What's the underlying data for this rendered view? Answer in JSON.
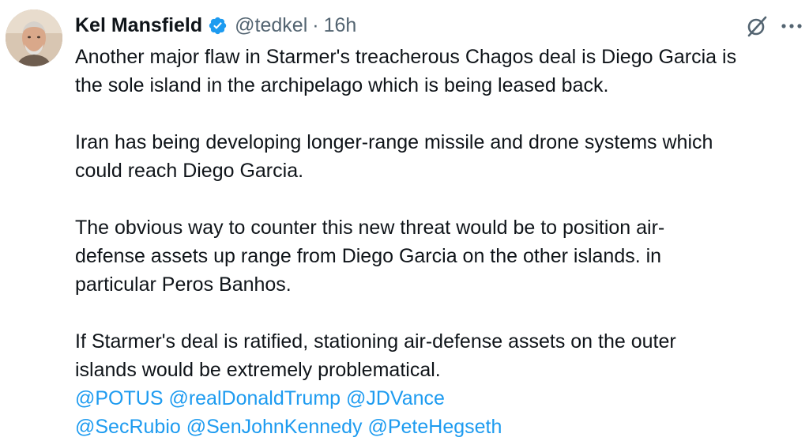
{
  "tweet": {
    "author": {
      "name": "Kel Mansfield",
      "handle": "@tedkel",
      "separator": "·",
      "time": "16h",
      "verified": true
    },
    "actions": {
      "grok_icon": "grok-icon",
      "more_icon": "more-dots-icon"
    },
    "paragraphs": [
      {
        "lines": [
          "Another major flaw in Starmer's treacherous Chagos deal is Diego Garcia is",
          "the sole island in the archipelago which is being leased back."
        ]
      },
      {
        "lines": [
          "Iran has being developing longer-range missile and drone systems which",
          "could reach Diego Garcia."
        ]
      },
      {
        "lines": [
          "The obvious way to counter this new threat would be to position air-",
          "defense assets up range from Diego Garcia on the other islands. in",
          "particular Peros Banhos."
        ]
      },
      {
        "lines": [
          "If Starmer's deal is ratified, stationing air-defense assets on the outer",
          "islands would be extremely problematical."
        ]
      }
    ],
    "mentions": [
      [
        "@POTUS",
        "@realDonaldTrump",
        "@JDVance"
      ],
      [
        "@SecRubio",
        "@SenJohnKennedy",
        "@PeteHegseth"
      ]
    ],
    "colors": {
      "text": "#0f1419",
      "secondary": "#536471",
      "link": "#1d9bf0",
      "verified": "#1d9bf0"
    }
  }
}
